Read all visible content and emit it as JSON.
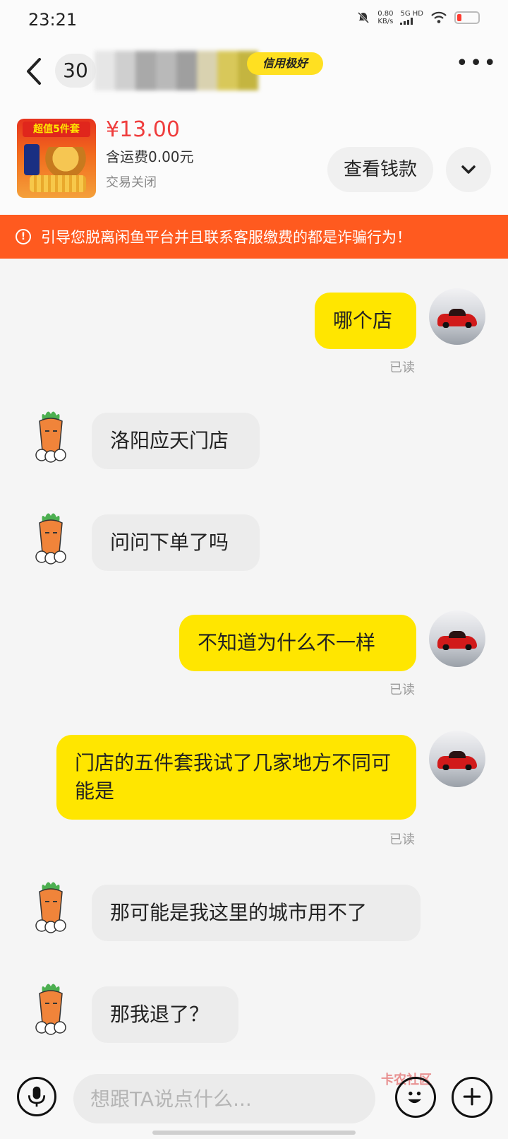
{
  "status_bar": {
    "time": "23:21",
    "net_speed_value": "0.80",
    "net_speed_unit": "KB/s",
    "network": "5G HD"
  },
  "header": {
    "count": "30",
    "credit_badge": "信用极好"
  },
  "product": {
    "thumb_label": "超值5件套",
    "price": "¥13.00",
    "shipping": "含运费0.00元",
    "status": "交易关闭",
    "view_money_button": "查看钱款"
  },
  "warning": {
    "text": "引导您脱离闲鱼平台并且联系客服缴费的都是诈骗行为！"
  },
  "messages": [
    {
      "side": "mine",
      "text": "哪个店",
      "read": "已读"
    },
    {
      "side": "theirs",
      "text": "洛阳应天门店"
    },
    {
      "side": "theirs",
      "text": "问问下单了吗"
    },
    {
      "side": "mine",
      "text": "不知道为什么不一样",
      "read": "已读"
    },
    {
      "side": "mine",
      "text": "门店的五件套我试了几家地方不同可能是",
      "read": "已读"
    },
    {
      "side": "theirs",
      "text": "那可能是我这里的城市用不了"
    },
    {
      "side": "theirs",
      "text": "那我退了？"
    }
  ],
  "input_bar": {
    "placeholder": "想跟TA说点什么...",
    "watermark": "卡农社区"
  },
  "colors": {
    "my_bubble": "#ffe600",
    "their_bubble": "#ececec",
    "warning_bg": "#ff5a1f",
    "price": "#ef3d3d"
  }
}
